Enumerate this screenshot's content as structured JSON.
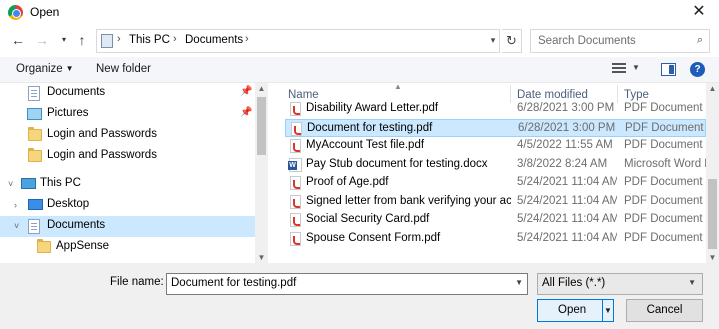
{
  "window": {
    "title": "Open",
    "close_glyph": "✕"
  },
  "address": {
    "crumbs": [
      "This PC",
      "Documents"
    ],
    "search_placeholder": "Search Documents"
  },
  "toolbar": {
    "organize_label": "Organize",
    "new_folder_label": "New folder"
  },
  "nav": {
    "items": [
      {
        "label": "Documents",
        "icon": "documents-folder-icon",
        "pinned": true
      },
      {
        "label": "Pictures",
        "icon": "pictures-icon",
        "pinned": true
      },
      {
        "label": "Login and Passwords",
        "icon": "folder-icon",
        "pinned": false
      },
      {
        "label": "Login and Passwords",
        "icon": "folder-icon",
        "pinned": false
      },
      {
        "label": "This PC",
        "icon": "this-pc-icon",
        "pinned": false
      },
      {
        "label": "Desktop",
        "icon": "desktop-icon",
        "pinned": false
      },
      {
        "label": "Documents",
        "icon": "documents-folder-icon",
        "pinned": false,
        "selected": true
      },
      {
        "label": "AppSense",
        "icon": "folder-icon",
        "pinned": false
      }
    ]
  },
  "columns": {
    "name": "Name",
    "date": "Date modified",
    "type": "Type"
  },
  "files": [
    {
      "name": "Disability Award Letter.pdf",
      "date": "6/28/2021 3:00 PM",
      "type": "PDF Document",
      "icon": "pdf-icon"
    },
    {
      "name": "Document for testing.pdf",
      "date": "6/28/2021 3:00 PM",
      "type": "PDF Document",
      "icon": "pdf-icon",
      "selected": true
    },
    {
      "name": "MyAccount Test file.pdf",
      "date": "4/5/2022 11:55 AM",
      "type": "PDF Document",
      "icon": "pdf-icon"
    },
    {
      "name": "Pay Stub document for testing.docx",
      "date": "3/8/2022 8:24 AM",
      "type": "Microsoft Word D",
      "icon": "word-icon"
    },
    {
      "name": "Proof of Age.pdf",
      "date": "5/24/2021 11:04 AM",
      "type": "PDF Document",
      "icon": "pdf-icon"
    },
    {
      "name": "Signed letter from bank verifying your ac...",
      "date": "5/24/2021 11:04 AM",
      "type": "PDF Document",
      "icon": "pdf-icon"
    },
    {
      "name": "Social Security Card.pdf",
      "date": "5/24/2021 11:04 AM",
      "type": "PDF Document",
      "icon": "pdf-icon"
    },
    {
      "name": "Spouse Consent Form.pdf",
      "date": "5/24/2021 11:04 AM",
      "type": "PDF Document",
      "icon": "pdf-icon"
    }
  ],
  "bottom": {
    "file_name_label": "File name:",
    "file_name_value": "Document for testing.pdf",
    "file_type_value": "All Files (*.*)",
    "open_label": "Open",
    "cancel_label": "Cancel"
  },
  "colors": {
    "selection_bg": "#cce8ff",
    "selection_border": "#99d1ff",
    "primary_button_border": "#0078d7"
  }
}
